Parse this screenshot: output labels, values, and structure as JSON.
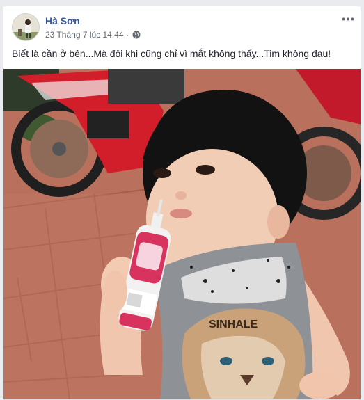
{
  "post": {
    "author": "Hà Sơn",
    "timestamp": "23 Tháng 7 lúc 14:44",
    "separator": "·",
    "privacy_icon": "globe-icon",
    "more_icon": "more-options-icon",
    "caption": "Biết là cần ở bên...Mà đôi khi cũng chỉ vì mắt không thấy...Tim không đau!",
    "photo_print_text": "SINHALE",
    "colors": {
      "author_link": "#365899",
      "meta_text": "#616770",
      "body_text": "#1d2129",
      "page_background": "#e9ebee"
    }
  }
}
